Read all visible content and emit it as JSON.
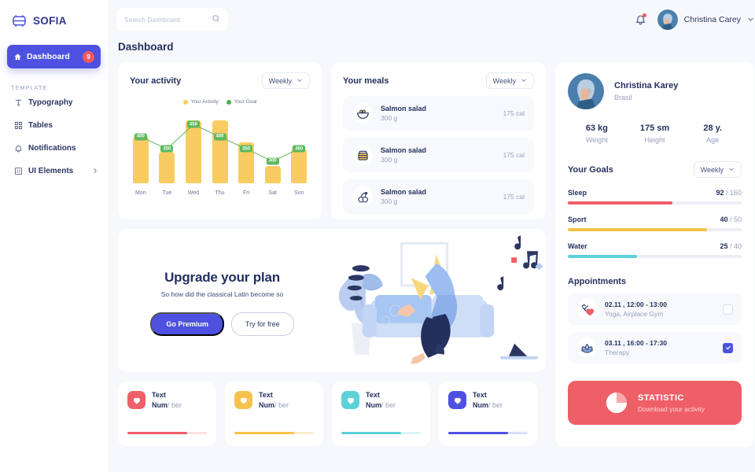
{
  "brand": {
    "name": "SOFIA",
    "icon": "sofia-logo-icon"
  },
  "sidebar": {
    "active": {
      "label": "Dashboard",
      "badge": "9",
      "icon": "home-icon"
    },
    "section_label": "TEMPLATE",
    "items": [
      {
        "label": "Typography",
        "icon": "typography-icon"
      },
      {
        "label": "Tables",
        "icon": "tables-icon"
      },
      {
        "label": "Notifications",
        "icon": "bell-icon"
      },
      {
        "label": "UI Elements",
        "icon": "ui-elements-icon",
        "chevron": "chevron-right-icon"
      }
    ]
  },
  "topbar": {
    "search_placeholder": "Search Dashboard",
    "search_value": "",
    "search_icon": "search-icon",
    "bell_icon": "bell-icon",
    "user_name": "Christina Carey",
    "chevron": "chevron-down-icon"
  },
  "page_title": "Dashboard",
  "activity": {
    "title": "Your activity",
    "period": "Weekly",
    "legend": [
      {
        "label": "Your Activity",
        "color": "#f9cc62"
      },
      {
        "label": "Your Goal",
        "color": "#4caf50"
      }
    ]
  },
  "chart_data": {
    "type": "bar",
    "title": "Your activity",
    "categories": [
      "Mon",
      "Tue",
      "Wed",
      "Thu",
      "Fri",
      "Sat",
      "Sun"
    ],
    "xlabel": "",
    "ylabel": "",
    "ylim": [
      0,
      500
    ],
    "grid": false,
    "legend_position": "top-center",
    "series": [
      {
        "name": "Your Activity",
        "type": "bar",
        "color": "#f9cc62",
        "values": [
          375,
          250,
          500,
          500,
          325,
          140,
          275
        ]
      },
      {
        "name": "Your Goal",
        "type": "line",
        "color": "#5cb85c",
        "values": [
          400,
          350,
          450,
          400,
          350,
          300,
          350
        ],
        "labels": [
          "400",
          "350",
          "450",
          "400",
          "350",
          "300",
          "350"
        ]
      }
    ]
  },
  "meals": {
    "title": "Your meals",
    "period": "Weekly",
    "items": [
      {
        "name": "Salmon salad",
        "weight": "300 g",
        "cal": "175 cal",
        "icon": "salad-bowl-icon"
      },
      {
        "name": "Salmon salad",
        "weight": "300 g",
        "cal": "175 cal",
        "icon": "cake-icon"
      },
      {
        "name": "Salmon salad",
        "weight": "300 g",
        "cal": "175 cal",
        "icon": "cherries-icon"
      }
    ]
  },
  "upgrade": {
    "title": "Upgrade your plan",
    "subtitle": "So how did the classical Latin become so",
    "primary_btn": "Go Premium",
    "ghost_btn": "Try for free",
    "illustration": "handstand-yoga-illustration"
  },
  "stat_cards": [
    {
      "text": "Text",
      "num": "Num",
      "unit": "/ ber",
      "color": "#ef5f68",
      "track": "#fbdfe1",
      "fill_pct": 75,
      "icon": "heart-icon"
    },
    {
      "text": "Text",
      "num": "Num",
      "unit": "/ ber",
      "color": "#f5c34b",
      "track": "#fbeec9",
      "fill_pct": 75,
      "icon": "heart-icon"
    },
    {
      "text": "Text",
      "num": "Num",
      "unit": "/ ber",
      "color": "#5ad2d8",
      "track": "#d9f4f6",
      "fill_pct": 75,
      "icon": "heart-icon"
    },
    {
      "text": "Text",
      "num": "Num",
      "unit": "/ ber",
      "color": "#4e51e0",
      "track": "#dcdefa",
      "fill_pct": 75,
      "icon": "heart-icon"
    }
  ],
  "profile": {
    "name": "Christina Karey",
    "location": "Brasil",
    "avatar": "user-avatar",
    "metrics": [
      {
        "value": "63 kg",
        "label": "Weight"
      },
      {
        "value": "175 sm",
        "label": "Height"
      },
      {
        "value": "28 y.",
        "label": "Age"
      }
    ]
  },
  "goals": {
    "title": "Your Goals",
    "period": "Weekly",
    "items": [
      {
        "name": "Sleep",
        "current": "92",
        "total": "/ 160",
        "pct": 60,
        "color": "#ef5f68"
      },
      {
        "name": "Sport",
        "current": "40",
        "total": "/ 50",
        "pct": 80,
        "color": "#f5c34b"
      },
      {
        "name": "Water",
        "current": "25",
        "total": "/ 40",
        "pct": 40,
        "color": "#5ad2d8"
      }
    ]
  },
  "appointments": {
    "title": "Appointments",
    "items": [
      {
        "time": "02.11 , 12:00 - 13:00",
        "desc": "Yoga, Airplace Gym",
        "checked": false,
        "icon": "dumbbell-heart-icon"
      },
      {
        "time": "03.11 , 16:00 - 17:30",
        "desc": "Therapy",
        "checked": true,
        "icon": "lotus-icon"
      }
    ]
  },
  "statistic": {
    "title": "STATISTIC",
    "subtitle": "Download your activity",
    "icon": "pie-chart-icon",
    "color": "#ef5f68"
  }
}
